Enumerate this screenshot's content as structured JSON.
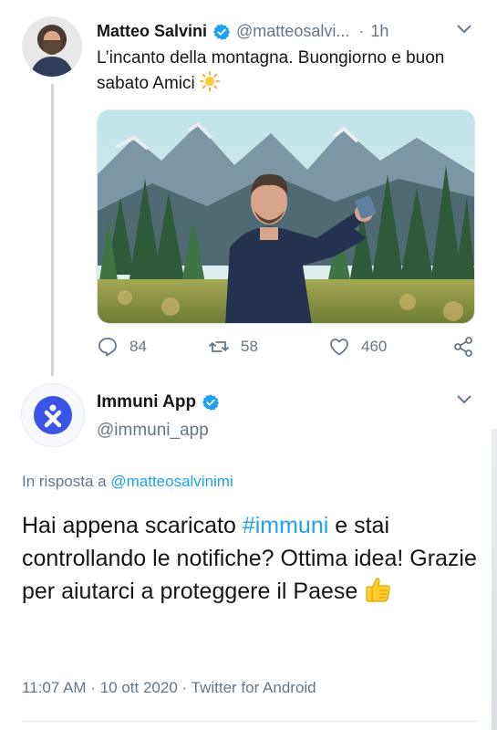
{
  "tweet": {
    "author_name": "Matteo Salvini",
    "author_handle": "@matteosalvi...",
    "time_separator": "·",
    "time": "1h",
    "text": "L’incanto della montagna. Buongiorno e buon sabato Amici",
    "emoji_icon": "sun-icon",
    "actions": {
      "replies": "84",
      "retweets": "58",
      "likes": "460"
    }
  },
  "reply": {
    "author_name": "Immuni App",
    "author_handle": "@immuni_app",
    "in_reply_label": "In risposta a",
    "in_reply_handle": "@matteosalvinimi",
    "text_part1": "Hai appena scaricato",
    "hashtag": "#immuni",
    "text_part2": "e stai controllando le notifiche? Ottima idea! Grazie per aiutarci a proteggere il Paese",
    "emoji_icon": "thumbs-up-icon",
    "time": "11:07 AM",
    "date": "10 ott 2020",
    "source": "Twitter for Android",
    "separator": "·"
  },
  "colors": {
    "accent": "#1da1f2",
    "text": "#14171a",
    "muted": "#657786",
    "verified": "#1da1f2",
    "immuni_brand": "#3b53e6"
  }
}
